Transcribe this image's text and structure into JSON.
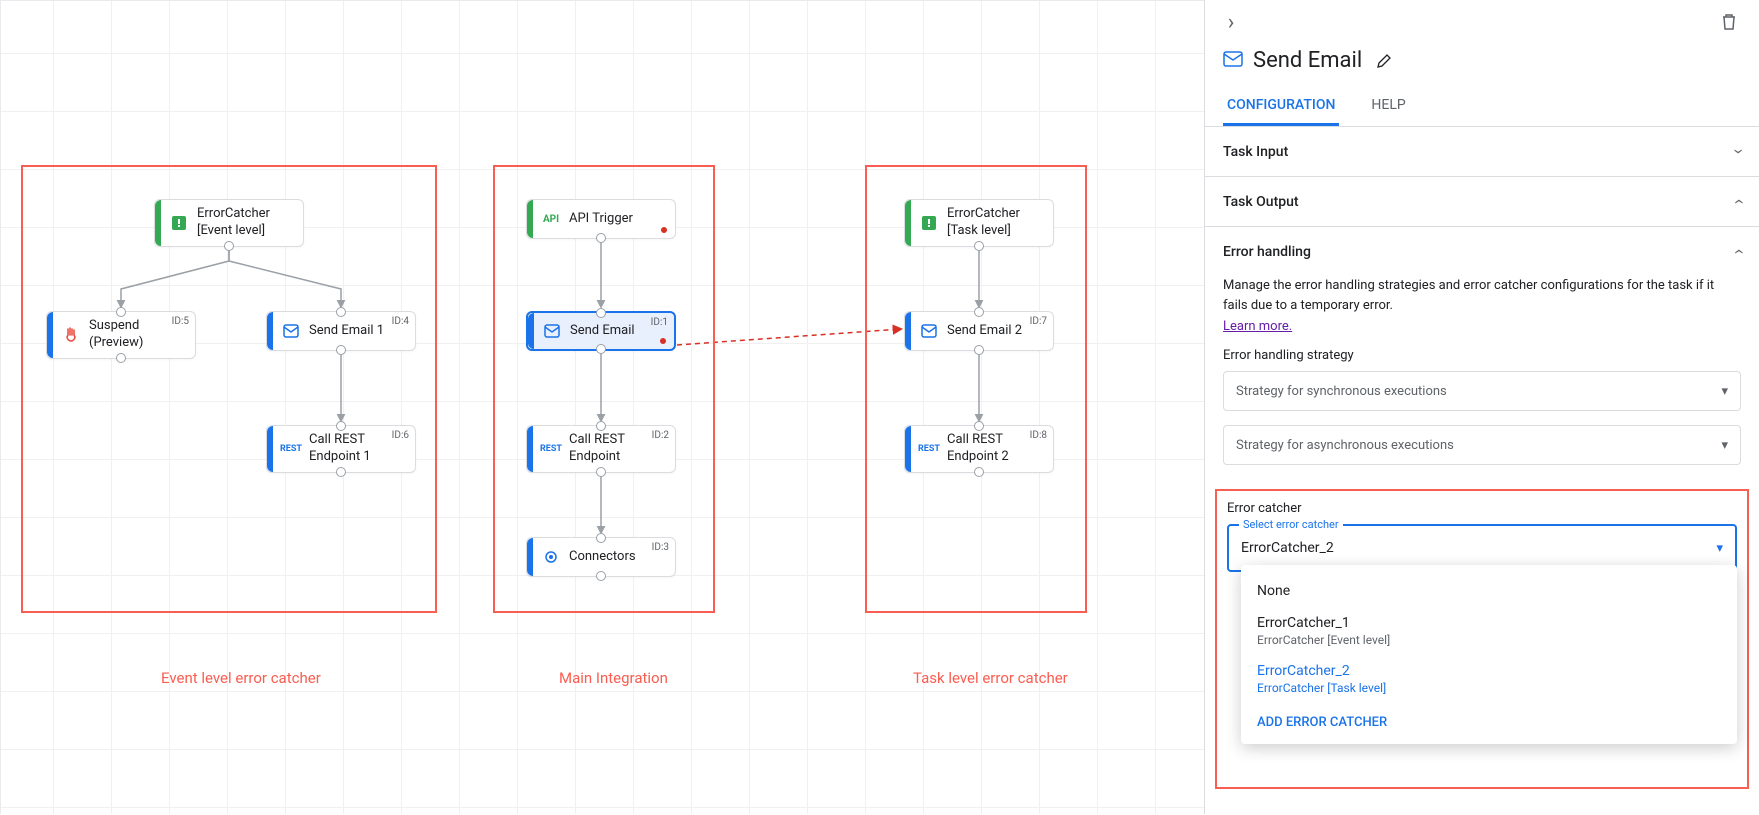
{
  "canvas": {
    "groups": [
      {
        "id": "g1",
        "caption": "Event level error catcher"
      },
      {
        "id": "g2",
        "caption": "Main Integration"
      },
      {
        "id": "g3",
        "caption": "Task level error catcher"
      }
    ],
    "nodes": {
      "ec_event": {
        "label": "ErrorCatcher [Event level]"
      },
      "suspend": {
        "label": "Suspend (Preview)",
        "id": "ID:5"
      },
      "send1": {
        "label": "Send Email 1",
        "id": "ID:4"
      },
      "rest1": {
        "label": "Call REST Endpoint 1",
        "id": "ID:6"
      },
      "api": {
        "label": "API Trigger"
      },
      "send": {
        "label": "Send Email",
        "id": "ID:1"
      },
      "rest": {
        "label": "Call REST Endpoint",
        "id": "ID:2"
      },
      "conn": {
        "label": "Connectors",
        "id": "ID:3"
      },
      "ec_task": {
        "label": "ErrorCatcher [Task level]"
      },
      "send2": {
        "label": "Send Email 2",
        "id": "ID:7"
      },
      "rest2": {
        "label": "Call REST Endpoint 2",
        "id": "ID:8"
      }
    }
  },
  "panel": {
    "title": "Send Email",
    "tabs": {
      "configuration": "CONFIGURATION",
      "help": "HELP"
    },
    "sections": {
      "task_input": "Task Input",
      "task_output": "Task Output",
      "error_handling": "Error handling"
    },
    "error_handling": {
      "description": "Manage the error handling strategies and error catcher configurations for the task if it fails due to a temporary error.",
      "learn_more": "Learn more.",
      "strategy_label": "Error handling strategy",
      "sync_placeholder": "Strategy for synchronous executions",
      "async_placeholder": "Strategy for asynchronous executions"
    },
    "error_catcher": {
      "section_label": "Error catcher",
      "field_label": "Select error catcher",
      "value": "ErrorCatcher_2",
      "options": [
        {
          "primary": "None"
        },
        {
          "primary": "ErrorCatcher_1",
          "secondary": "ErrorCatcher [Event level]"
        },
        {
          "primary": "ErrorCatcher_2",
          "secondary": "ErrorCatcher [Task level]",
          "selected": true
        }
      ],
      "add_action": "ADD ERROR CATCHER"
    }
  }
}
